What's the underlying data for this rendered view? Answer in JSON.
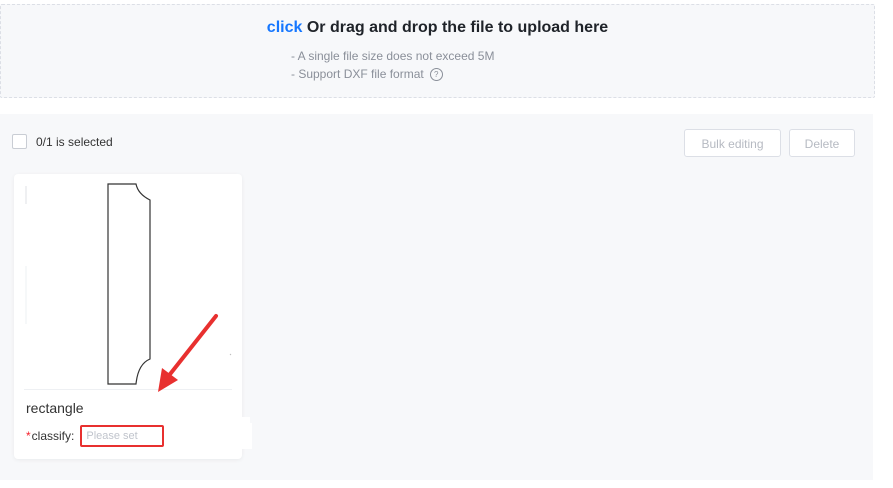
{
  "upload": {
    "click_text": "click",
    "title_rest": "Or drag and drop the file to upload here",
    "hint_size": "- A single file size does not exceed 5M",
    "hint_format": "- Support DXF file format"
  },
  "toolbar": {
    "selected_text": "0/1 is selected",
    "bulk_label": "Bulk editing",
    "delete_label": "Delete"
  },
  "card": {
    "name": "rectangle",
    "required_mark": "*",
    "classify_label": "classify:",
    "classify_placeholder": "Please set",
    "classify_value": ""
  },
  "colors": {
    "accent": "#1677ff",
    "highlight": "#e8302f",
    "required": "#f5222d"
  },
  "icons": [
    "help-icon",
    "dxf-preview",
    "annotation-arrow"
  ]
}
